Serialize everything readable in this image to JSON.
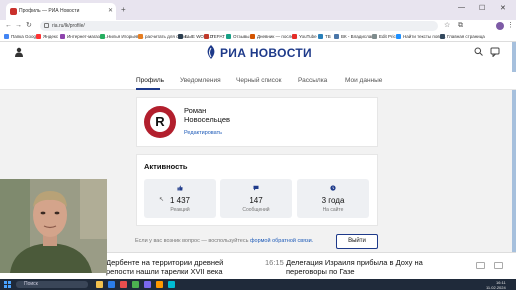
{
  "browser": {
    "tabs": [
      {
        "title": "Профиль — РИА Новости"
      },
      {
        "title": ""
      }
    ],
    "url": "ria.ru/lk/profile/",
    "bookmarks": [
      {
        "label": "Папка Google",
        "color": "#4285f4"
      },
      {
        "label": "Яндекс",
        "color": "#f33"
      },
      {
        "label": "Интернет-магазин...",
        "color": "#8e44ad"
      },
      {
        "label": "Нилья Игорьевна",
        "color": "#27ae60"
      },
      {
        "label": "расчитать для соли...",
        "color": "#e67e22"
      },
      {
        "label": "БЫЕ WORLD",
        "color": "#2c3e50"
      },
      {
        "label": "ТЕРАТ",
        "color": "#c0392b"
      },
      {
        "label": "Отзывы",
        "color": "#16a085"
      },
      {
        "label": "Дневник — после...",
        "color": "#d35400"
      },
      {
        "label": "YouTube",
        "color": "#e52d27"
      },
      {
        "label": "ТВ",
        "color": "#2980b9"
      },
      {
        "label": "ВК - Владислав...",
        "color": "#4a76a8"
      },
      {
        "label": "Edit Prices",
        "color": "#7f8c8d"
      },
      {
        "label": "Найти тексты повс...",
        "color": "#1e90ff"
      },
      {
        "label": "Главная страница",
        "color": "#34495e"
      }
    ]
  },
  "site": {
    "logo_text": "РИА НОВОСТИ",
    "brand_color": "#1e3a8a",
    "subnav": [
      {
        "label": "Профиль",
        "active": true
      },
      {
        "label": "Уведомления",
        "active": false
      },
      {
        "label": "Черный список",
        "active": false
      },
      {
        "label": "Рассылка",
        "active": false
      },
      {
        "label": "Мои данные",
        "active": false
      }
    ]
  },
  "profile": {
    "avatar_letter": "R",
    "first_name": "Роман",
    "last_name": "Новосельцев",
    "edit_label": "Редактировать"
  },
  "activity": {
    "title": "Активность",
    "stats": [
      {
        "value": "1 437",
        "label": "Реакций",
        "icon": "thumbs-up-icon"
      },
      {
        "value": "147",
        "label": "Сообщений",
        "icon": "speech-bubble-icon"
      },
      {
        "value": "3 года",
        "label": "На сайте",
        "icon": "clock-icon"
      }
    ]
  },
  "footer": {
    "note": "Если у вас возник вопрос — воспользуйтесь",
    "feedback_link": "формой обратной связи.",
    "logout_label": "Выйти"
  },
  "news": [
    {
      "time": "",
      "text1": "Дербенте на территории древней",
      "text2": "репости нашли тарелки XVII века"
    },
    {
      "time": "16:15",
      "text1": "Делегация Израиля прибыла в Доху на",
      "text2": "переговоры по Газе"
    }
  ],
  "taskbar": {
    "search_placeholder": "Поиск",
    "time": "16:11",
    "date": "11.02.2024"
  }
}
